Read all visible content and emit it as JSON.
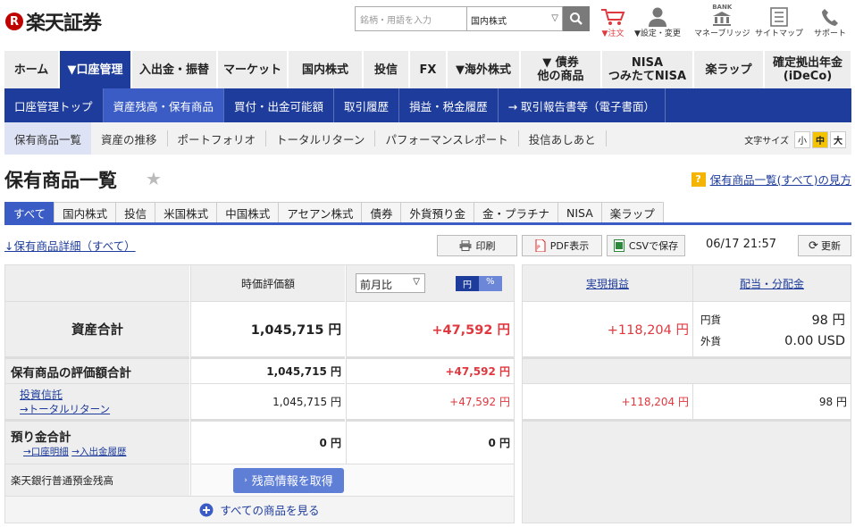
{
  "header": {
    "logo_text": "楽天証券",
    "logo_mark": "R",
    "search_placeholder": "銘柄・用語を入力",
    "market_select": "国内株式",
    "icons": [
      {
        "name": "cart-icon",
        "label": "▼注文"
      },
      {
        "name": "user-icon",
        "label": "▼設定・変更"
      },
      {
        "name": "bank-icon",
        "label": "マネーブリッジ"
      },
      {
        "name": "sitemap-icon",
        "label": "サイトマップ"
      },
      {
        "name": "phone-icon",
        "label": "サポート"
      }
    ],
    "bank_text": "BANK"
  },
  "nav1": [
    {
      "label": "ホーム",
      "w": 60
    },
    {
      "label": "▼口座管理",
      "w": 79,
      "on": true
    },
    {
      "label": "入出金・振替",
      "w": 94
    },
    {
      "label": "マーケット",
      "w": 77
    },
    {
      "label": "国内株式",
      "w": 82
    },
    {
      "label": "投信",
      "w": 50
    },
    {
      "label": "FX",
      "w": 40
    },
    {
      "label": "▼海外株式",
      "w": 80
    },
    {
      "label": "▼ 債券\n他の商品",
      "w": 89
    },
    {
      "label": "NISA\nつみたてNISA",
      "w": 101
    },
    {
      "label": "楽ラップ",
      "w": 77
    },
    {
      "label": "確定拠出年金\n(iDeCo)",
      "w": 96
    }
  ],
  "nav2": [
    {
      "label": "口座管理トップ"
    },
    {
      "label": "資産残高・保有商品",
      "on": true
    },
    {
      "label": "買付・出金可能額"
    },
    {
      "label": "取引履歴"
    },
    {
      "label": "損益・税金履歴"
    },
    {
      "label": "→ 取引報告書等（電子書面）"
    }
  ],
  "nav3": [
    {
      "label": "保有商品一覧",
      "on": true
    },
    {
      "label": "資産の推移"
    },
    {
      "label": "ポートフォリオ"
    },
    {
      "label": "トータルリターン"
    },
    {
      "label": "パフォーマンスレポート"
    },
    {
      "label": "投信あしあと"
    }
  ],
  "font_size": {
    "label": "文字サイズ",
    "small": "小",
    "mid": "中",
    "large": "大"
  },
  "page": {
    "title": "保有商品一覧",
    "help_text": "保有商品一覧(すべて)の見方"
  },
  "tabs": [
    "すべて",
    "国内株式",
    "投信",
    "米国株式",
    "中国株式",
    "アセアン株式",
    "債券",
    "外貨預り金",
    "金・プラチナ",
    "NISA",
    "楽ラップ"
  ],
  "toolbar": {
    "detail_link": "↓保有商品詳細（すべて）",
    "print": "印刷",
    "pdf": "PDF表示",
    "csv": "CSVで保存",
    "timestamp": "06/17 21:57",
    "refresh": "更新"
  },
  "table": {
    "col_value": "時価評価額",
    "compare_select": "前月比",
    "unit_yen": "円",
    "unit_pct": "%",
    "col_realized": "実現損益",
    "col_dividend": "配当・分配金",
    "total_label": "資産合計",
    "total_value": "1,045,715 円",
    "total_change": "+47,592 円",
    "total_realized": "+118,204 円",
    "div_yen_label": "円貨",
    "div_yen": "98 円",
    "div_fx_label": "外貨",
    "div_fx": "0.00 USD",
    "eval_label": "保有商品の評価額合計",
    "eval_value": "1,045,715 円",
    "eval_change": "+47,592 円",
    "fund_label": "投資信託",
    "fund_link": "→トータルリターン",
    "fund_value": "1,045,715 円",
    "fund_change": "+47,592 円",
    "fund_realized": "+118,204 円",
    "fund_div": "98 円",
    "dep_label": "預り金合計",
    "dep_link1": "→口座明細",
    "dep_link2": "→入出金履歴",
    "dep_value": "0 円",
    "dep_change": "0 円",
    "bank_label": "楽天銀行普通預金残高",
    "bank_button": "残高情報を取得",
    "see_all": "すべての商品を見る"
  }
}
